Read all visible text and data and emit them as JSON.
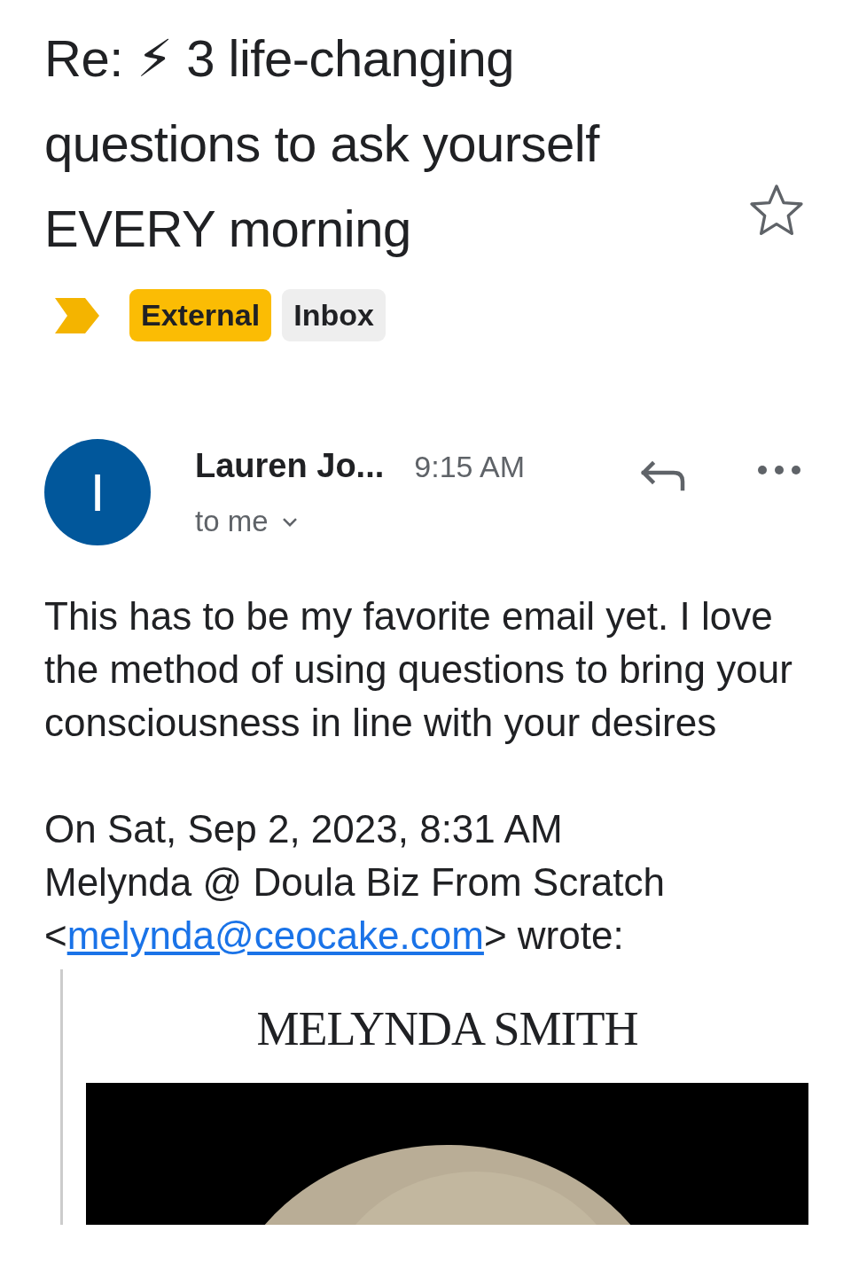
{
  "subject": {
    "title": "Re: ⚡ 3 life-changing questions to ask yourself EVERY morning",
    "starred": false,
    "important": true
  },
  "labels": [
    {
      "text": "External",
      "color": "#fbbc04"
    },
    {
      "text": "Inbox",
      "color": "#eeeeee"
    }
  ],
  "message": {
    "avatar_letter": "I",
    "sender": "Lauren Jo...",
    "time": "9:15 AM",
    "recipient": "to me",
    "body": "This has to be my favorite email yet. I love the method of using questions to bring your consciousness in line with your desires",
    "quote_header": {
      "date_line": "On Sat, Sep 2, 2023, 8:31 AM",
      "sender_line": "Melynda @ Doula Biz From Scratch",
      "prefix": "<",
      "email": "melynda@ceocake.com",
      "suffix": "> wrote:"
    },
    "quoted": {
      "heading": "MELYNDA SMITH"
    }
  }
}
